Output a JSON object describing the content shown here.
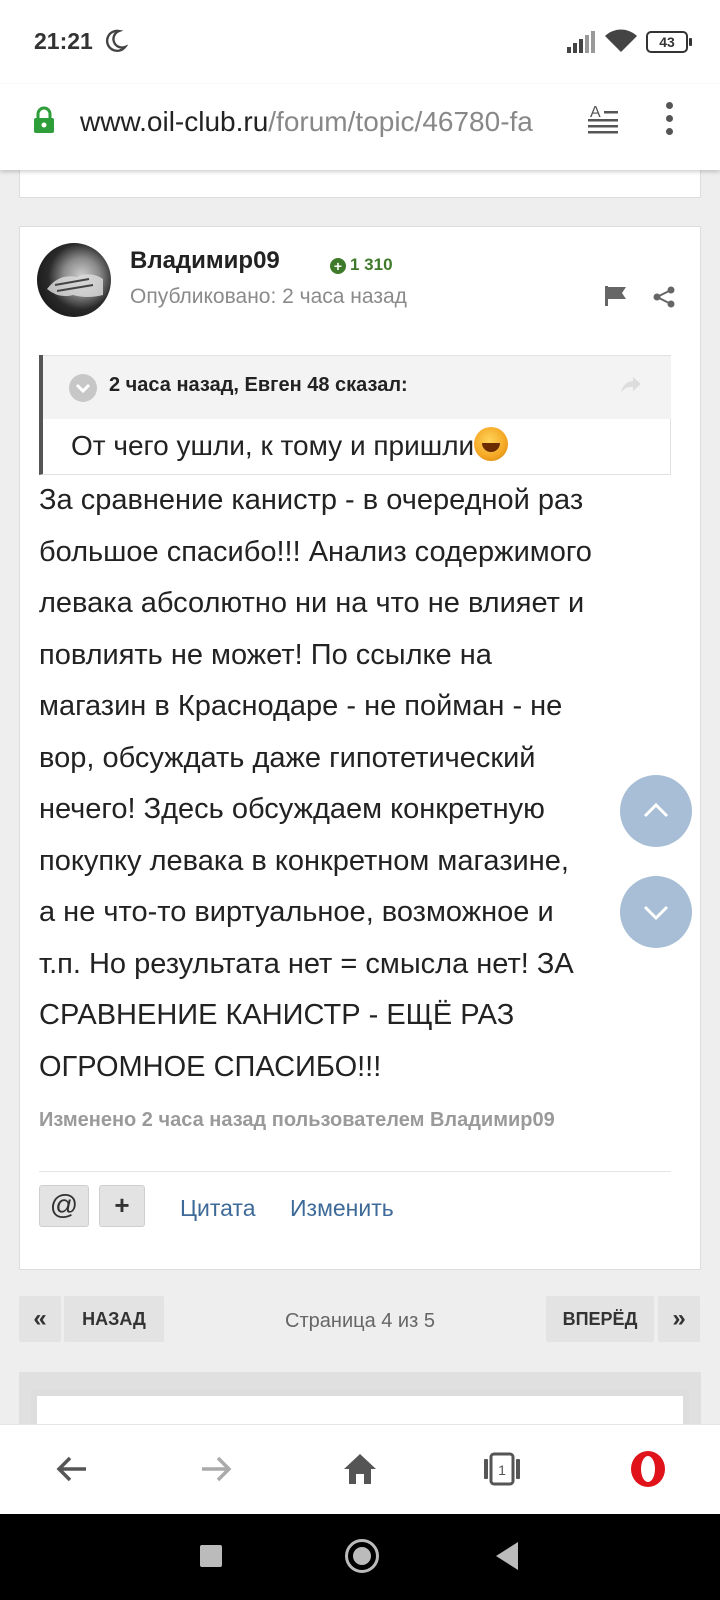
{
  "status_bar": {
    "time": "21:21",
    "battery": "43"
  },
  "url_bar": {
    "host": "www.oil-club.ru",
    "path": "/forum/topic/46780-fa"
  },
  "post": {
    "author": "Владимир09",
    "reputation": "1 310",
    "posted": "Опубликовано: 2 часа назад",
    "quote": {
      "citation": "2 часа назад, Евген 48 сказал:",
      "text": "От чего ушли, к тому и пришли"
    },
    "body_lines": [
      "За сравнение канистр - в очередной раз",
      "большое спасибо!!! Анализ содержимого",
      "левака абсолютно ни на что не влияет и",
      "повлиять не может! По ссылке на",
      "магазин в Краснодаре - не пойман - не",
      "вор, обсуждать даже гипотетический",
      "нечего! Здесь обсуждаем конкретную",
      "покупку левака в конкретном магазине,",
      "а не что-то виртуальное, возможное и",
      "т.п. Но результата нет = смысла нет! ЗА",
      "СРАВНЕНИЕ КАНИСТР - ЕЩЁ РАЗ",
      "ОГРОМНОЕ СПАСИБО!!!"
    ],
    "edited": "Изменено 2 часа назад пользователем Владимир09",
    "actions": {
      "mention": "@",
      "plus": "+",
      "quote": "Цитата",
      "edit": "Изменить"
    }
  },
  "pagination": {
    "first": "«",
    "prev": "НАЗАД",
    "info": "Страница 4 из 5",
    "next": "ВПЕРЁД",
    "last": "»"
  },
  "toolbar": {
    "tabs_count": "1"
  },
  "colors": {
    "link": "#3d6a98",
    "reputation": "#3f7a2a",
    "opera_red": "#e0131b"
  }
}
